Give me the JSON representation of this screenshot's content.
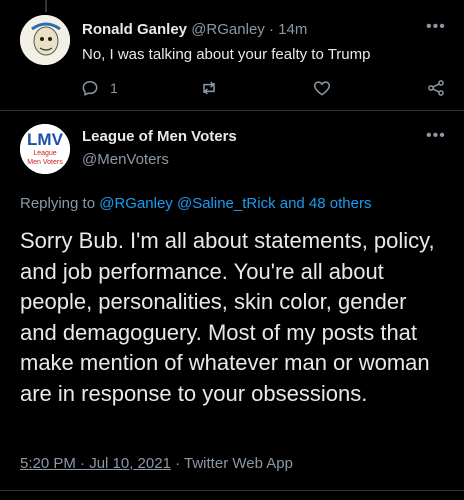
{
  "reply": {
    "name": "Ronald Ganley",
    "handle": "@RGanley",
    "sep": "·",
    "time": "14m",
    "text": "No, I was talking about your fealty to Trump",
    "reply_count": "1"
  },
  "main": {
    "name": "League of Men Voters",
    "handle": "@MenVoters",
    "avatar_text": {
      "top": "LMV",
      "line2": "League",
      "line3": "Men Voters"
    },
    "replying_prefix": "Replying to",
    "replying_targets": "@RGanley @Saline_tRick and 48 others",
    "text": "Sorry Bub. I'm all about statements, policy, and job performance.  You're all about people, personalities, skin color, gender and demagoguery.  Most of my posts that make mention of whatever man or woman are in response to your obsessions.",
    "timestamp": "5:20 PM · Jul 10, 2021",
    "sep": "·",
    "source": "Twitter Web App"
  },
  "icons": {
    "more": "more-dots-icon",
    "reply": "reply-icon",
    "retweet": "retweet-icon",
    "like": "heart-icon",
    "share": "share-icon"
  },
  "colors": {
    "link": "#1d9bf0",
    "muted": "#8b98a5",
    "text": "#e7e9ea"
  }
}
